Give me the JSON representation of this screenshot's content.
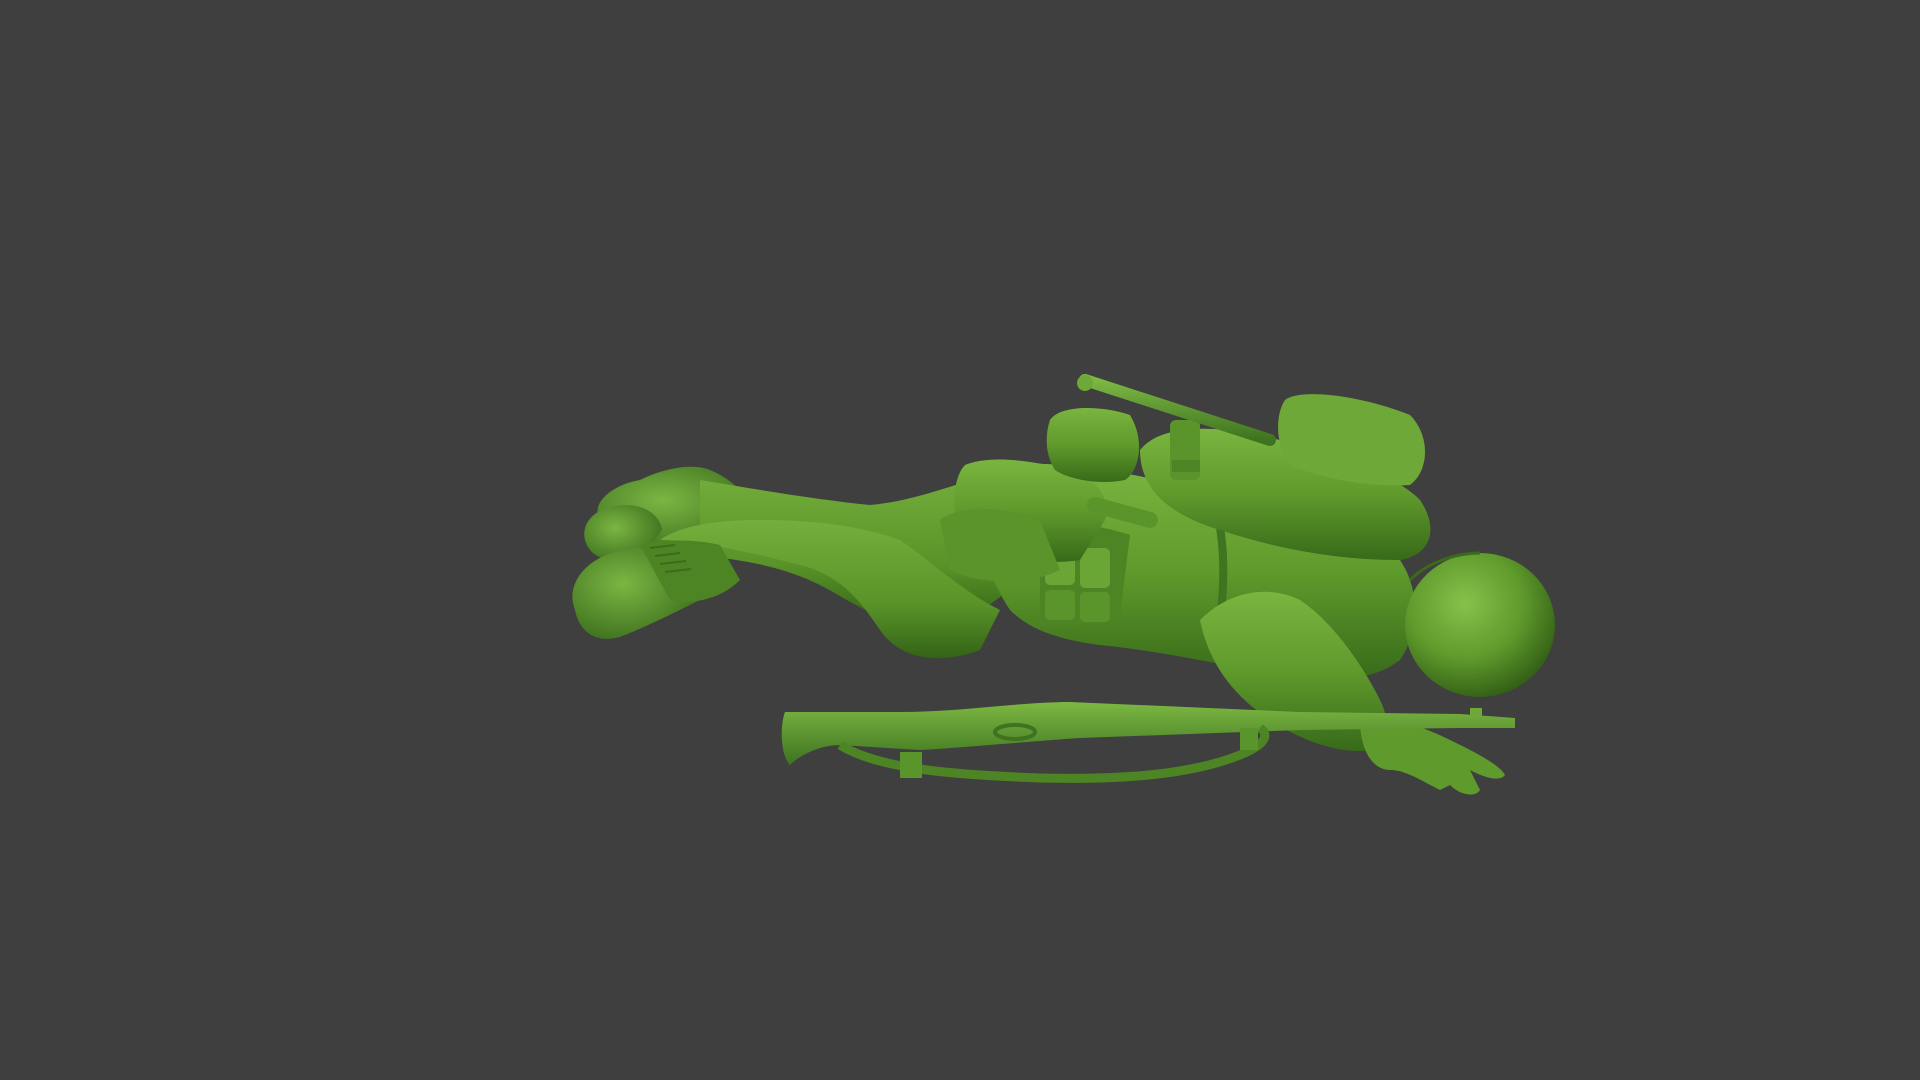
{
  "scene": {
    "background_color": "#3f3f3f",
    "model_color": "#5f9a2c",
    "model_highlight": "#86c24a",
    "model_shadow": "#2f5a14",
    "subject": "green-plastic-army-soldier-figure"
  }
}
